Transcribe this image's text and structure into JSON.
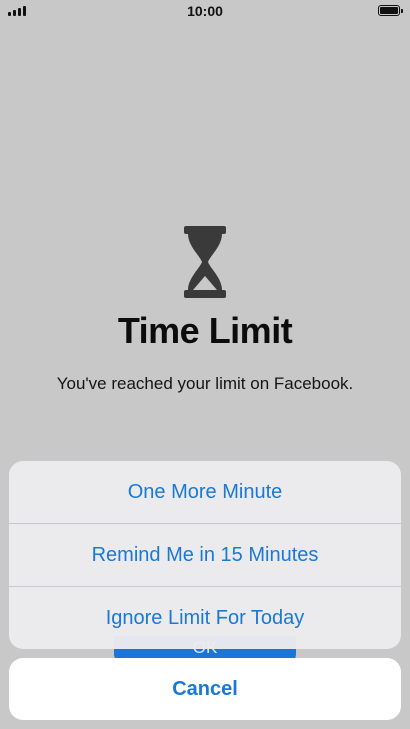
{
  "status_bar": {
    "time": "10:00",
    "signal_icon": "cellular-signal-icon",
    "battery_icon": "battery-full-icon"
  },
  "alert": {
    "icon": "hourglass-icon",
    "title": "Time Limit",
    "message": "You've reached your limit on Facebook.",
    "ok_label": "OK"
  },
  "action_sheet": {
    "items": [
      {
        "label": "One More Minute"
      },
      {
        "label": "Remind Me in 15 Minutes"
      },
      {
        "label": "Ignore Limit For Today"
      }
    ],
    "cancel_label": "Cancel"
  },
  "colors": {
    "background": "#c8c8c8",
    "accent": "#1a78d6",
    "sheet_background": "#ececee",
    "hourglass": "#3a3a3a"
  }
}
